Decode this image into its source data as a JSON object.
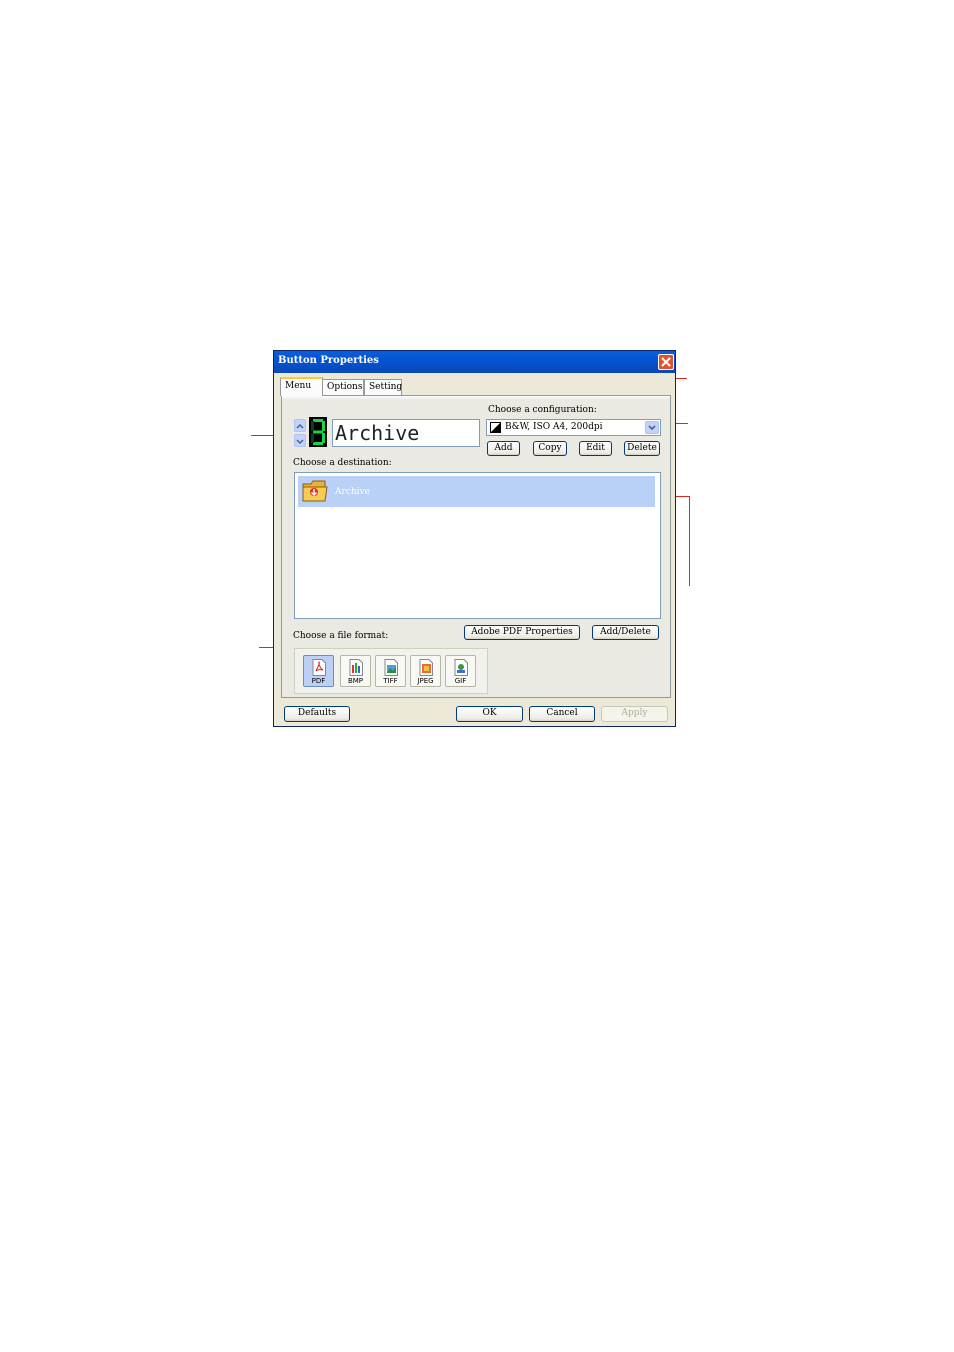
{
  "window": {
    "title": "Button Properties"
  },
  "tabs": [
    {
      "label": "Menu"
    },
    {
      "label": "Options"
    },
    {
      "label": "Setting"
    }
  ],
  "menu_tab": {
    "button_number": "3",
    "button_name": "Archive",
    "configuration": {
      "label": "Choose a configuration:",
      "selected": "B&W, ISO A4, 200dpi",
      "buttons": {
        "add": "Add",
        "copy": "Copy",
        "edit": "Edit",
        "delete": "Delete"
      }
    },
    "destination": {
      "label": "Choose a destination:",
      "items": [
        {
          "label": "Archive",
          "icon": "archive-folder-icon",
          "selected": true
        }
      ]
    },
    "adobe_pdf_properties": "Adobe PDF Properties",
    "add_delete": "Add/Delete",
    "file_format": {
      "label": "Choose a file format:",
      "formats": [
        {
          "label": "PDF",
          "selected": true
        },
        {
          "label": "BMP",
          "selected": false
        },
        {
          "label": "TIFF",
          "selected": false
        },
        {
          "label": "JPEG",
          "selected": false
        },
        {
          "label": "GIF",
          "selected": false
        }
      ]
    }
  },
  "footer": {
    "defaults": "Defaults",
    "ok": "OK",
    "cancel": "Cancel",
    "apply": "Apply"
  },
  "colors": {
    "titlebar": "#0554d1",
    "callout_lines": "#d22b2b",
    "selection": "#b9d1f7"
  }
}
